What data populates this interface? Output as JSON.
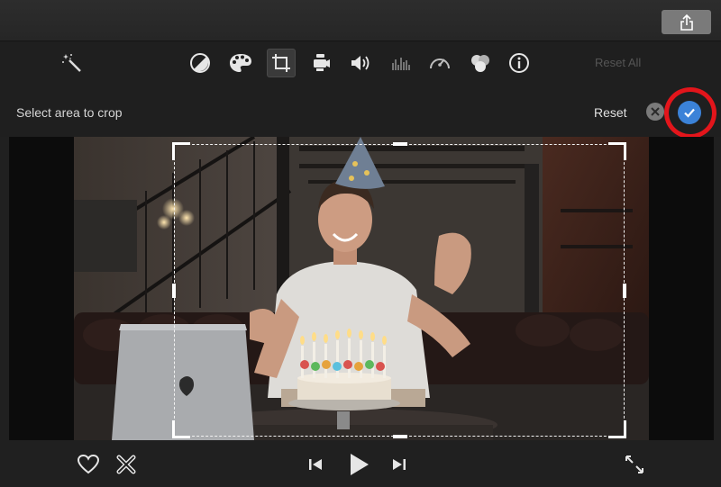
{
  "toolbar": {
    "reset_all_label": "Reset All"
  },
  "crop_bar": {
    "instruction": "Select area to crop",
    "reset_label": "Reset"
  },
  "colors": {
    "accent": "#3b82d8",
    "highlight": "#e3151b"
  }
}
